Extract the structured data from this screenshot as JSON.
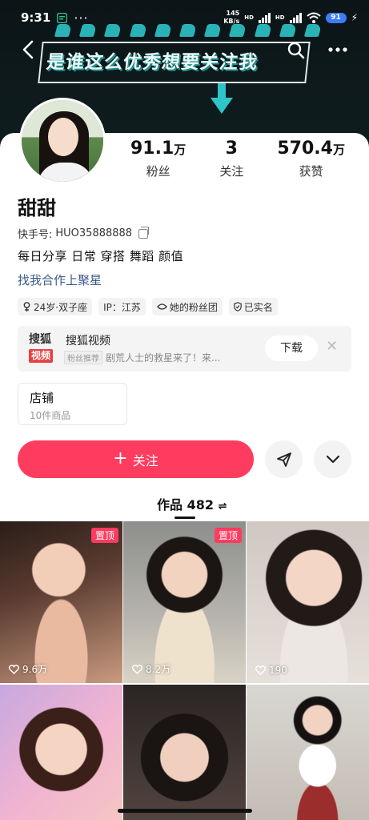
{
  "status_bar": {
    "time": "9:31",
    "net_speed_value": "145",
    "net_speed_unit": "KB/s",
    "sim1": "HD",
    "sim2": "HD",
    "battery": "91"
  },
  "banner": {
    "title": "是谁这么优秀想要关注我"
  },
  "profile": {
    "name": "甜甜",
    "kuaishou_id_label": "快手号:",
    "kuaishou_id": "HUO35888888",
    "bio": "每日分享 日常  穿搭  舞蹈  颜值",
    "link": "找我合作上聚星",
    "stats": [
      {
        "value": "91.1",
        "unit": "万",
        "label": "粉丝"
      },
      {
        "value": "3",
        "unit": "",
        "label": "关注"
      },
      {
        "value": "570.4",
        "unit": "万",
        "label": "获赞"
      }
    ],
    "tags": [
      {
        "icon": "gender-female-icon",
        "text": "24岁·双子座"
      },
      {
        "icon": "",
        "text": "IP：江苏"
      },
      {
        "icon": "fan-group-icon",
        "text": "她的粉丝团"
      },
      {
        "icon": "verified-shield-icon",
        "text": "已实名"
      }
    ]
  },
  "ad": {
    "logo_top": "搜狐",
    "logo_bottom": "视频",
    "title": "搜狐视频",
    "badge": "粉丝推荐",
    "subtitle": "剧荒人士的救星来了！来...",
    "download_label": "下载",
    "close_glyph": "✕"
  },
  "shop": {
    "title": "店铺",
    "subtitle": "10件商品"
  },
  "actions": {
    "follow_label": "关注"
  },
  "works_tab": {
    "label": "作品 482",
    "sort_glyph": "⇌"
  },
  "works": [
    {
      "pinned_label": "置顶",
      "likes": "9.6万"
    },
    {
      "pinned_label": "置顶",
      "likes": "8.2万"
    },
    {
      "pinned_label": "",
      "likes": "190"
    },
    {
      "pinned_label": "",
      "likes": ""
    },
    {
      "pinned_label": "",
      "likes": ""
    },
    {
      "pinned_label": "",
      "likes": ""
    }
  ],
  "colors": {
    "accent": "#fe3c5f",
    "link": "#3a5a8c",
    "banner_bg": "#0e1a1c",
    "banner_teal": "#2ec4c9"
  }
}
